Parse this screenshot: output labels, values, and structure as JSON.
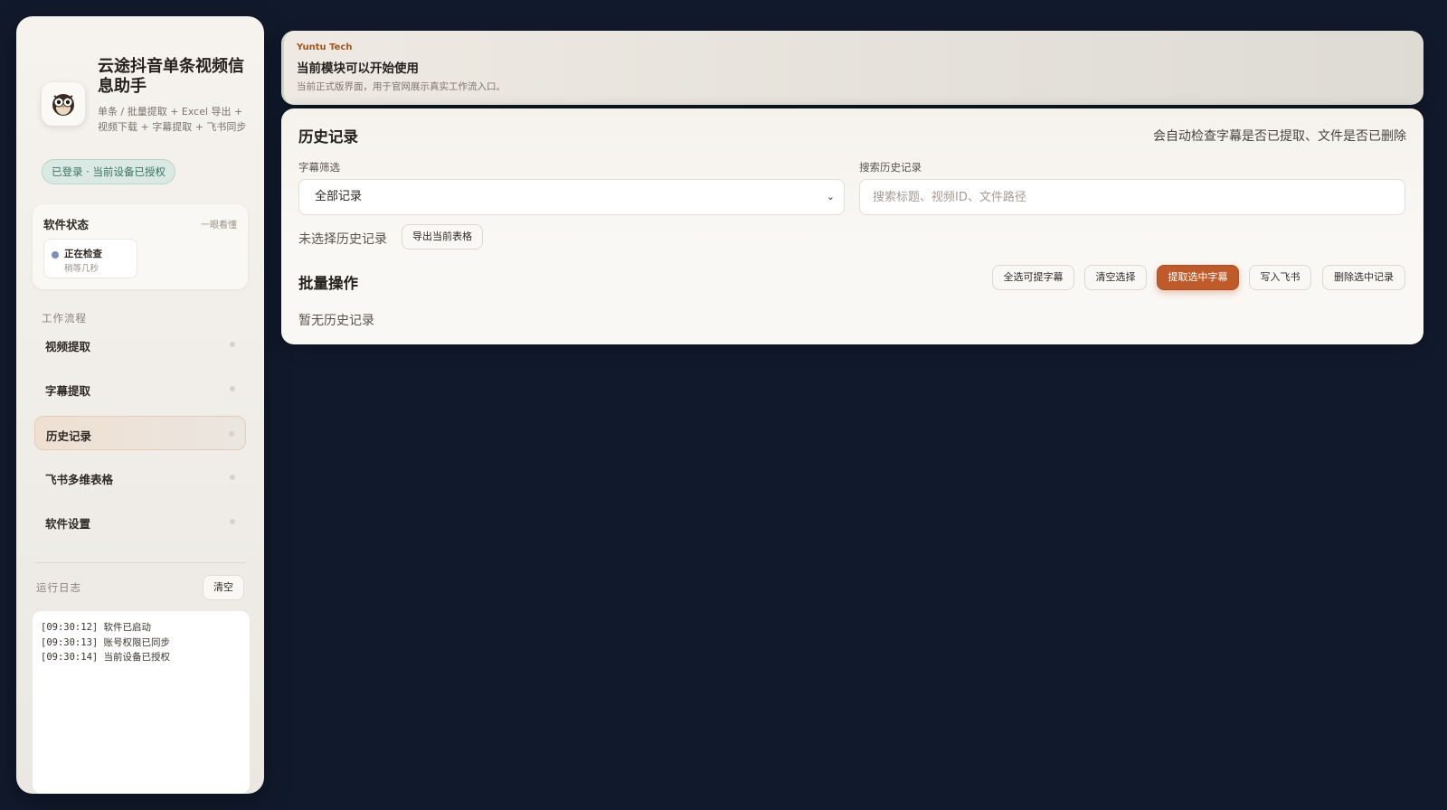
{
  "sidebar": {
    "app_title": "云途抖音单条视频信息助手",
    "app_desc": "单条 / 批量提取 + Excel 导出 + 视频下载 + 字幕提取 + 飞书同步",
    "auth_badge": "已登录 · 当前设备已授权",
    "status": {
      "title": "软件状态",
      "hint": "一眼看懂",
      "main": "正在检查",
      "sub": "稍等几秒"
    },
    "workflow_label": "工作流程",
    "nav": [
      {
        "label": "视频提取",
        "active": false
      },
      {
        "label": "字幕提取",
        "active": false
      },
      {
        "label": "历史记录",
        "active": true
      },
      {
        "label": "飞书多维表格",
        "active": false
      },
      {
        "label": "软件设置",
        "active": false
      }
    ],
    "log_label": "运行日志",
    "log_clear": "清空",
    "logs": [
      "[09:30:12] 软件已启动",
      "[09:30:13] 账号权限已同步",
      "[09:30:14] 当前设备已授权"
    ]
  },
  "banner": {
    "brand": "Yuntu Tech",
    "title": "当前模块可以开始使用",
    "desc": "当前正式版界面，用于官网展示真实工作流入口。"
  },
  "history": {
    "title": "历史记录",
    "note": "会自动检查字幕是否已提取、文件是否已删除",
    "filter_label": "字幕筛选",
    "filter_value": "全部记录",
    "search_label": "搜索历史记录",
    "search_placeholder": "搜索标题、视频ID、文件路径",
    "search_value": "",
    "no_selection": "未选择历史记录",
    "export_button": "导出当前表格",
    "batch_title": "批量操作",
    "batch_buttons": {
      "select_all": "全选可提字幕",
      "clear": "清空选择",
      "extract": "提取选中字幕",
      "feishu": "写入飞书",
      "delete": "删除选中记录"
    },
    "empty": "暂无历史记录"
  },
  "colors": {
    "background": "#111a2c",
    "accent": "#bf5a2a",
    "auth_badge": "#3b7463"
  }
}
